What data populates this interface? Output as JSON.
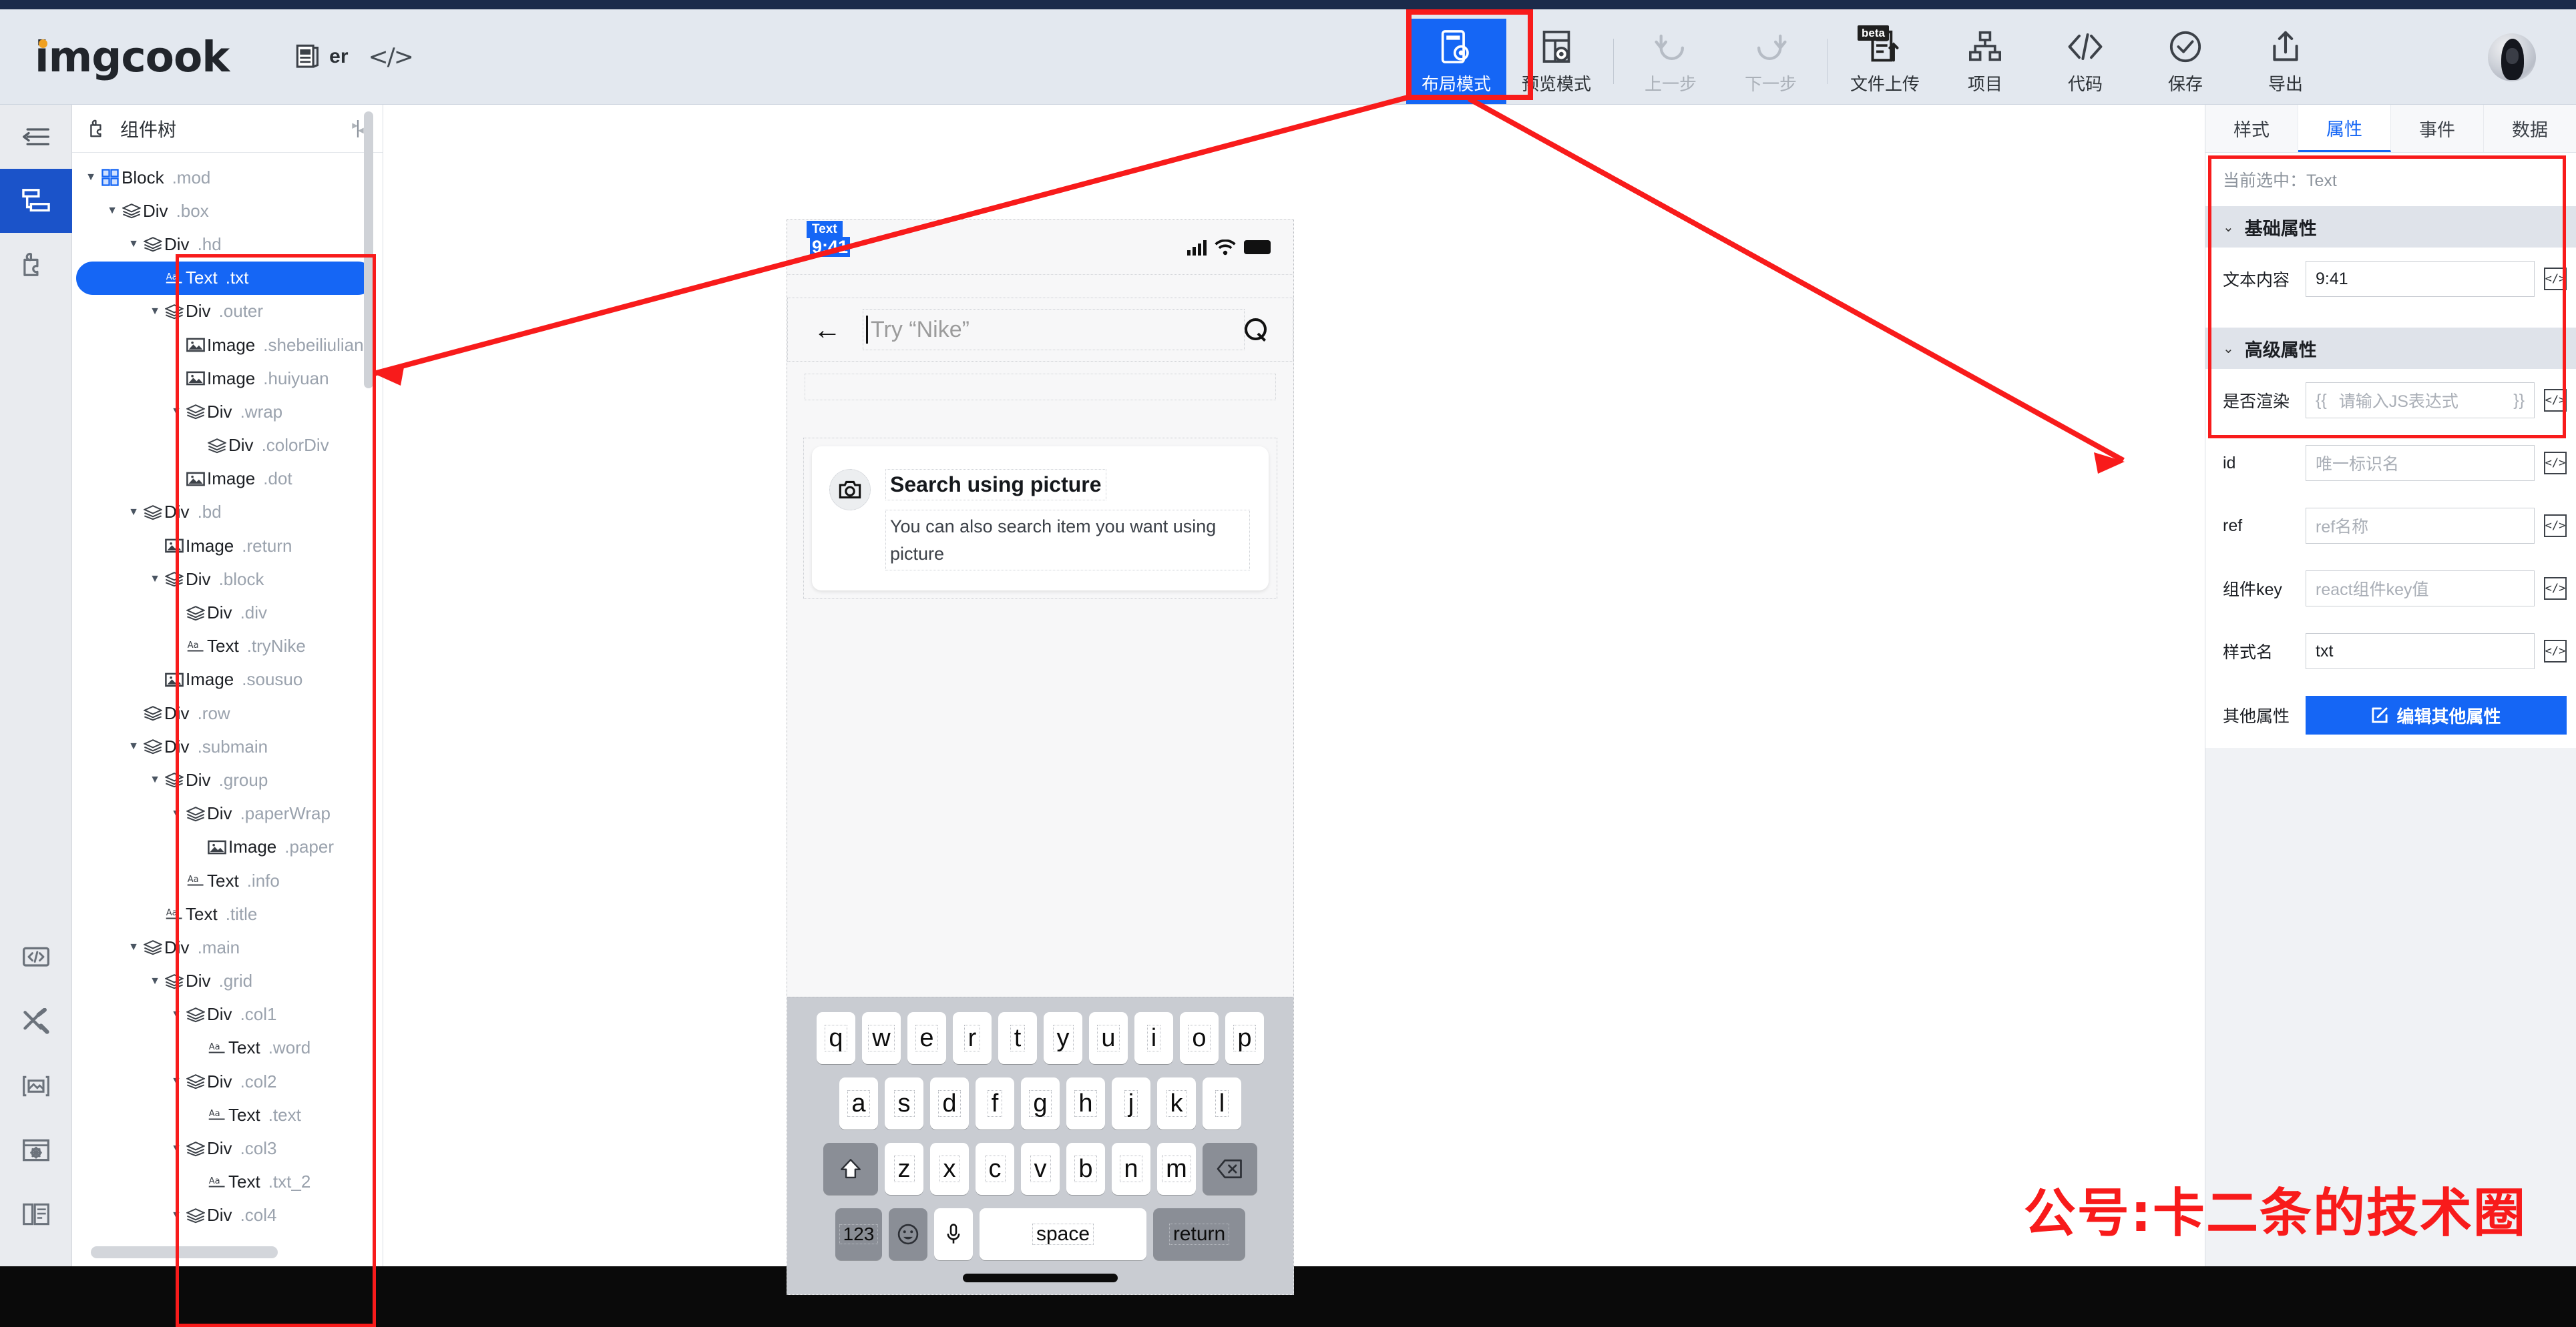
{
  "header": {
    "logo": "imgcook",
    "doc_label": "er",
    "code_icon": "</>",
    "toolbar": [
      {
        "label": "布局模式",
        "icon": "layout-mode-icon",
        "state": "active"
      },
      {
        "label": "预览模式",
        "icon": "preview-mode-icon",
        "state": "normal"
      },
      {
        "label": "上一步",
        "icon": "undo-icon",
        "state": "disabled"
      },
      {
        "label": "下一步",
        "icon": "redo-icon",
        "state": "disabled"
      },
      {
        "label": "文件上传",
        "icon": "file-upload-icon",
        "state": "normal",
        "badge": "beta"
      },
      {
        "label": "项目",
        "icon": "project-icon",
        "state": "normal"
      },
      {
        "label": "代码",
        "icon": "code-icon",
        "state": "normal"
      },
      {
        "label": "保存",
        "icon": "save-check-icon",
        "state": "normal"
      },
      {
        "label": "导出",
        "icon": "export-icon",
        "state": "normal"
      }
    ]
  },
  "rail": {
    "items": [
      {
        "icon": "collapse-panel-icon",
        "active": false
      },
      {
        "icon": "component-tree-icon",
        "active": true
      },
      {
        "icon": "puzzle-icon",
        "active": false
      },
      {
        "icon": "code-window-icon",
        "active": false
      },
      {
        "icon": "tools-icon",
        "active": false
      },
      {
        "icon": "image-placeholder-icon",
        "active": false
      },
      {
        "icon": "settings-window-icon",
        "active": false
      },
      {
        "icon": "document-stack-icon",
        "active": false
      }
    ]
  },
  "tree": {
    "title": "组件树",
    "header_icon": "puzzle-icon",
    "filter_icon": "filter-icon",
    "nodes": [
      {
        "depth": 0,
        "twisty": "▼",
        "icon": "block-icon",
        "type": "Block",
        "cls": ".mod",
        "selected": false
      },
      {
        "depth": 1,
        "twisty": "▼",
        "icon": "layers-icon",
        "type": "Div",
        "cls": ".box",
        "selected": false
      },
      {
        "depth": 2,
        "twisty": "▼",
        "icon": "layers-icon",
        "type": "Div",
        "cls": ".hd",
        "selected": false
      },
      {
        "depth": 3,
        "twisty": "",
        "icon": "text-icon",
        "type": "Text",
        "cls": ".txt",
        "selected": true
      },
      {
        "depth": 3,
        "twisty": "▼",
        "icon": "layers-icon",
        "type": "Div",
        "cls": ".outer",
        "selected": false
      },
      {
        "depth": 4,
        "twisty": "",
        "icon": "image-icon",
        "type": "Image",
        "cls": ".shebeiliulian",
        "selected": false
      },
      {
        "depth": 4,
        "twisty": "",
        "icon": "image-icon",
        "type": "Image",
        "cls": ".huiyuan",
        "selected": false
      },
      {
        "depth": 4,
        "twisty": "▼",
        "icon": "layers-icon",
        "type": "Div",
        "cls": ".wrap",
        "selected": false
      },
      {
        "depth": 5,
        "twisty": "",
        "icon": "layers-icon",
        "type": "Div",
        "cls": ".colorDiv",
        "selected": false
      },
      {
        "depth": 4,
        "twisty": "",
        "icon": "image-icon",
        "type": "Image",
        "cls": ".dot",
        "selected": false
      },
      {
        "depth": 2,
        "twisty": "▼",
        "icon": "layers-icon",
        "type": "Div",
        "cls": ".bd",
        "selected": false
      },
      {
        "depth": 3,
        "twisty": "",
        "icon": "image-icon",
        "type": "Image",
        "cls": ".return",
        "selected": false
      },
      {
        "depth": 3,
        "twisty": "▼",
        "icon": "layers-icon",
        "type": "Div",
        "cls": ".block",
        "selected": false
      },
      {
        "depth": 4,
        "twisty": "",
        "icon": "layers-icon",
        "type": "Div",
        "cls": ".div",
        "selected": false
      },
      {
        "depth": 4,
        "twisty": "",
        "icon": "text-icon",
        "type": "Text",
        "cls": ".tryNike",
        "selected": false
      },
      {
        "depth": 3,
        "twisty": "",
        "icon": "image-icon",
        "type": "Image",
        "cls": ".sousuo",
        "selected": false
      },
      {
        "depth": 2,
        "twisty": "",
        "icon": "layers-icon",
        "type": "Div",
        "cls": ".row",
        "selected": false
      },
      {
        "depth": 2,
        "twisty": "▼",
        "icon": "layers-icon",
        "type": "Div",
        "cls": ".submain",
        "selected": false
      },
      {
        "depth": 3,
        "twisty": "▼",
        "icon": "layers-icon",
        "type": "Div",
        "cls": ".group",
        "selected": false
      },
      {
        "depth": 4,
        "twisty": "▼",
        "icon": "layers-icon",
        "type": "Div",
        "cls": ".paperWrap",
        "selected": false
      },
      {
        "depth": 5,
        "twisty": "",
        "icon": "image-icon",
        "type": "Image",
        "cls": ".paper",
        "selected": false
      },
      {
        "depth": 4,
        "twisty": "",
        "icon": "text-icon",
        "type": "Text",
        "cls": ".info",
        "selected": false
      },
      {
        "depth": 3,
        "twisty": "",
        "icon": "text-icon",
        "type": "Text",
        "cls": ".title",
        "selected": false
      },
      {
        "depth": 2,
        "twisty": "▼",
        "icon": "layers-icon",
        "type": "Div",
        "cls": ".main",
        "selected": false
      },
      {
        "depth": 3,
        "twisty": "▼",
        "icon": "layers-icon",
        "type": "Div",
        "cls": ".grid",
        "selected": false
      },
      {
        "depth": 4,
        "twisty": "▼",
        "icon": "layers-icon",
        "type": "Div",
        "cls": ".col1",
        "selected": false
      },
      {
        "depth": 5,
        "twisty": "",
        "icon": "text-icon",
        "type": "Text",
        "cls": ".word",
        "selected": false
      },
      {
        "depth": 4,
        "twisty": "▼",
        "icon": "layers-icon",
        "type": "Div",
        "cls": ".col2",
        "selected": false
      },
      {
        "depth": 5,
        "twisty": "",
        "icon": "text-icon",
        "type": "Text",
        "cls": ".text",
        "selected": false
      },
      {
        "depth": 4,
        "twisty": "▼",
        "icon": "layers-icon",
        "type": "Div",
        "cls": ".col3",
        "selected": false
      },
      {
        "depth": 5,
        "twisty": "",
        "icon": "text-icon",
        "type": "Text",
        "cls": ".txt_2",
        "selected": false
      },
      {
        "depth": 4,
        "twisty": "▼",
        "icon": "layers-icon",
        "type": "Div",
        "cls": ".col4",
        "selected": false
      }
    ]
  },
  "canvas": {
    "status_bar": {
      "time": "9:41",
      "selection_tag": "Text"
    },
    "search": {
      "placeholder": "Try “Nike”",
      "back_icon": "back-arrow-icon",
      "search_icon": "search-icon"
    },
    "card": {
      "icon": "camera-icon",
      "title": "Search using picture",
      "subtitle": "You can also search item you want using picture"
    },
    "keyboard": {
      "row1": [
        "q",
        "w",
        "e",
        "r",
        "t",
        "y",
        "u",
        "i",
        "o",
        "p"
      ],
      "row2": [
        "a",
        "s",
        "d",
        "f",
        "g",
        "h",
        "j",
        "k",
        "l"
      ],
      "row3": [
        "z",
        "x",
        "c",
        "v",
        "b",
        "n",
        "m"
      ],
      "shift_icon": "shift-icon",
      "backspace_icon": "backspace-icon",
      "num_key": "123",
      "emoji_icon": "emoji-icon",
      "mic_icon": "microphone-icon",
      "space_key": "space",
      "return_key": "return"
    }
  },
  "props": {
    "tabs": [
      {
        "label": "样式",
        "active": false
      },
      {
        "label": "属性",
        "active": true
      },
      {
        "label": "事件",
        "active": false
      },
      {
        "label": "数据",
        "active": false
      }
    ],
    "current_selection_label": "当前选中：",
    "current_selection_value": "Text",
    "basic": {
      "title": "基础属性",
      "fields": [
        {
          "label": "文本内容",
          "value": "9:41",
          "placeholder": "",
          "code_icon": "</>"
        }
      ]
    },
    "advanced": {
      "title": "高级属性",
      "fields": [
        {
          "label": "是否渲染",
          "value": "",
          "placeholder": "请输入JS表达式",
          "prefix": "{{",
          "suffix": "}}",
          "code_icon": "</>"
        },
        {
          "label": "id",
          "value": "",
          "placeholder": "唯一标识名",
          "code_icon": "</>"
        },
        {
          "label": "ref",
          "value": "",
          "placeholder": "ref名称",
          "code_icon": "</>"
        },
        {
          "label": "组件key",
          "value": "",
          "placeholder": "react组件key值",
          "code_icon": "</>"
        },
        {
          "label": "样式名",
          "value": "txt",
          "placeholder": "",
          "code_icon": "</>"
        }
      ],
      "other_label": "其他属性",
      "other_button": "编辑其他属性",
      "other_button_icon": "edit-square-icon"
    }
  },
  "watermark": "公号:卡二条的技术圈",
  "colors": {
    "accent": "#1566f5",
    "annotation": "#f81b1b",
    "header_bg": "#e3e8ef",
    "rail_active": "#1b53c9"
  }
}
